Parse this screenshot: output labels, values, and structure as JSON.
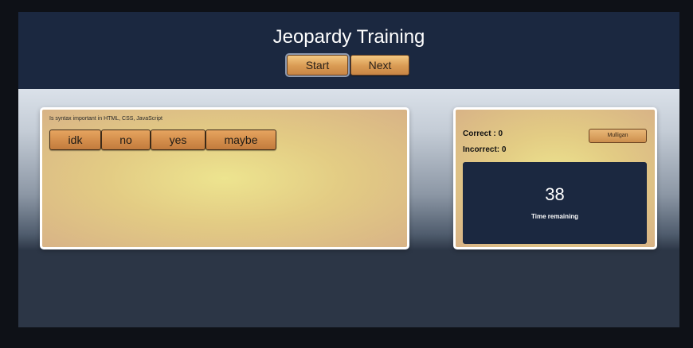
{
  "header": {
    "title": "Jeopardy Training",
    "start_label": "Start",
    "next_label": "Next"
  },
  "question": {
    "text": "Is syntax important in HTML, CSS, JavaScript",
    "answers": [
      "idk",
      "no",
      "yes",
      "maybe"
    ]
  },
  "score": {
    "correct_label": "Correct : 0",
    "incorrect_label": "Incorrect: 0",
    "mulligan_label": "Mulligan"
  },
  "timer": {
    "value": "38",
    "label": "Time remaining"
  },
  "colors": {
    "header_bg": "#1b2840",
    "button_gradient_top": "#f3c882",
    "button_gradient_bottom": "#c88545",
    "card_center": "#ede48f",
    "card_edge": "#d8b386",
    "page_bg": "#0e1117"
  }
}
